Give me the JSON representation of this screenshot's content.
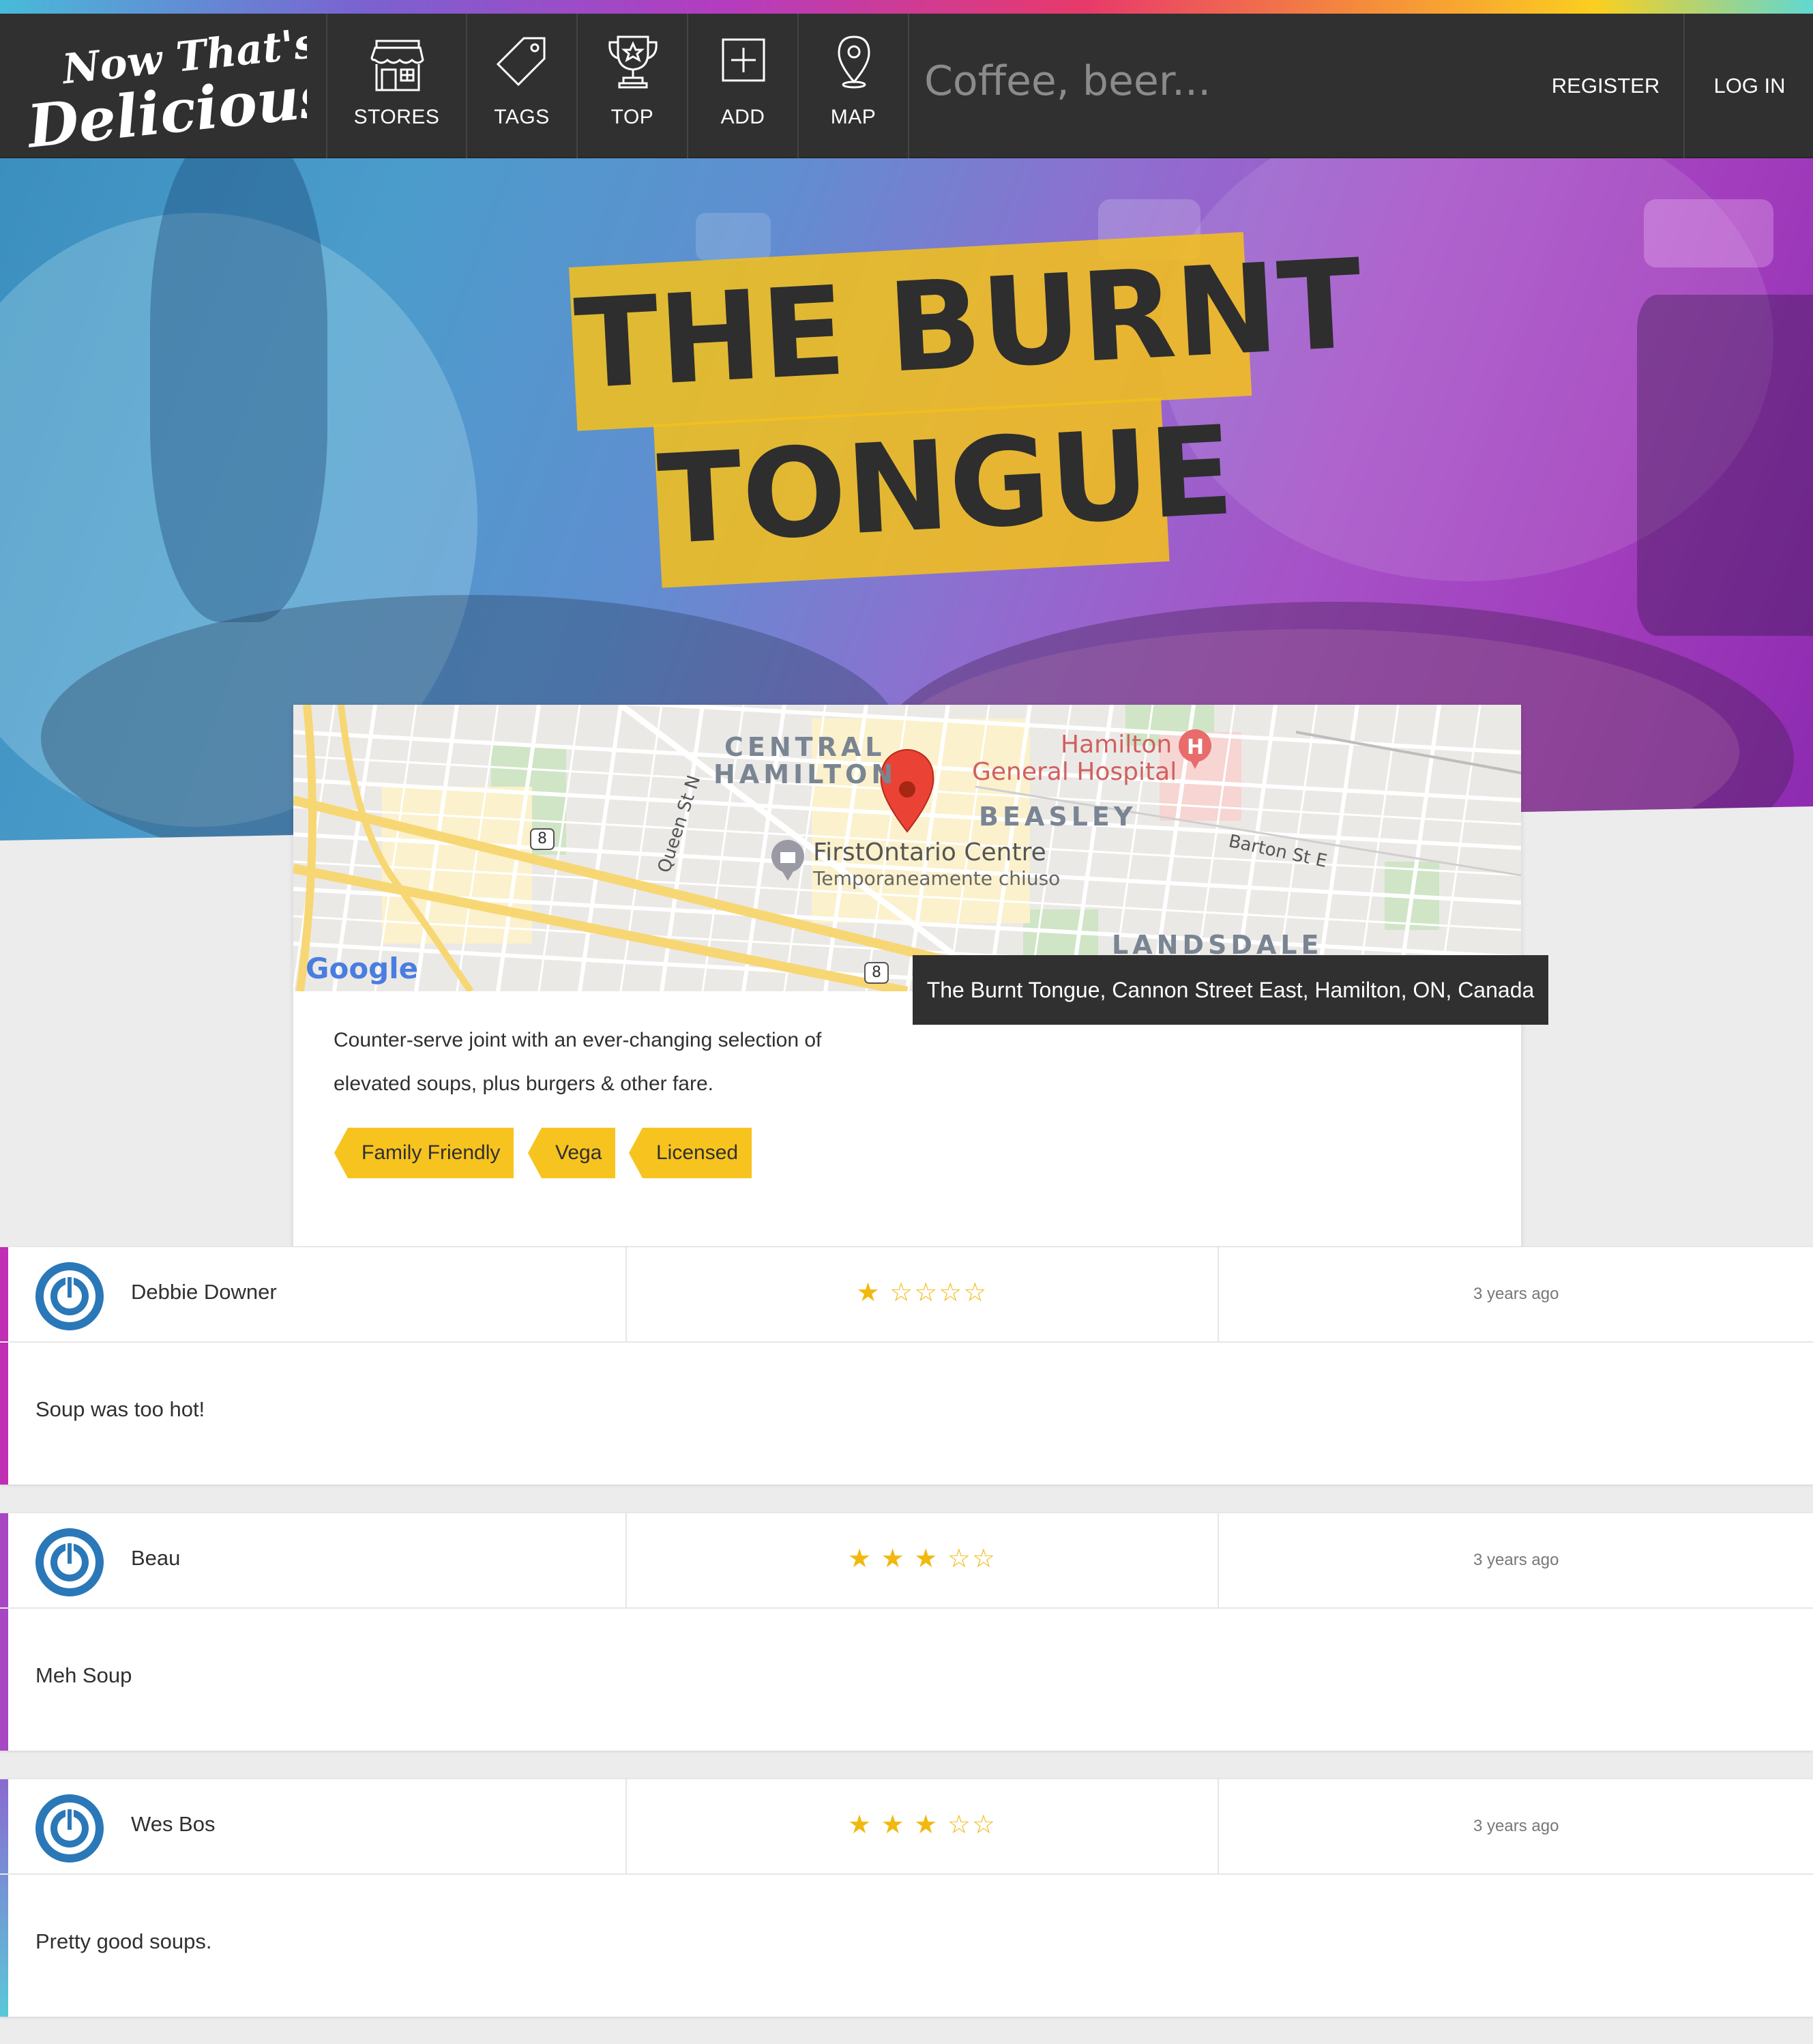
{
  "brand": {
    "logo_line1": "Now That's",
    "logo_line2": "Delicious!"
  },
  "nav": {
    "items": [
      {
        "label": "STORES",
        "icon": "store-icon"
      },
      {
        "label": "TAGS",
        "icon": "tag-icon"
      },
      {
        "label": "TOP",
        "icon": "trophy-icon"
      },
      {
        "label": "ADD",
        "icon": "add-icon"
      },
      {
        "label": "MAP",
        "icon": "map-pin-icon"
      }
    ],
    "search_placeholder": "Coffee, beer...",
    "register": "REGISTER",
    "login": "LOG IN"
  },
  "store": {
    "title_line1": "THE BURNT",
    "title_line2": "TONGUE",
    "description": "Counter-serve joint with an ever-changing selection of elevated soups, plus burgers & other fare.",
    "address_tooltip": "The Burnt Tongue, Cannon Street East, Hamilton, ON, Canada",
    "tags": [
      "Family Friendly",
      "Vega",
      "Licensed"
    ]
  },
  "map": {
    "labels": {
      "central_hamilton_1": "CENTRAL",
      "central_hamilton_2": "HAMILTON",
      "hospital_1": "Hamilton",
      "hospital_2": "General Hospital",
      "beasley": "BEASLEY",
      "firstontario": "FirstOntario Centre",
      "temp_closed": "Temporaneamente chiuso",
      "barton": "Barton St E",
      "queen": "Queen St N",
      "landsdale": "LANDSDALE",
      "route1": "8",
      "route2": "8",
      "google": "Google"
    }
  },
  "reviews": [
    {
      "author": "Debbie Downer",
      "rating": 1,
      "stars_display": "★ ☆☆☆☆",
      "time": "3 years ago",
      "text": "Soup was too hot!",
      "accent": "#c02fb4"
    },
    {
      "author": "Beau",
      "rating": 3,
      "stars_display": "★ ★ ★ ☆☆",
      "time": "3 years ago",
      "text": "Meh Soup",
      "accent": "#a847c4"
    },
    {
      "author": "Wes Bos",
      "rating": 3,
      "stars_display": "★ ★ ★ ☆☆",
      "time": "3 years ago",
      "text": "Pretty good soups.",
      "accent": "#6ea8d8"
    }
  ],
  "colors": {
    "nav_bg": "#303030",
    "accent_yellow": "#f7c31e",
    "page_bg": "#ececec"
  }
}
